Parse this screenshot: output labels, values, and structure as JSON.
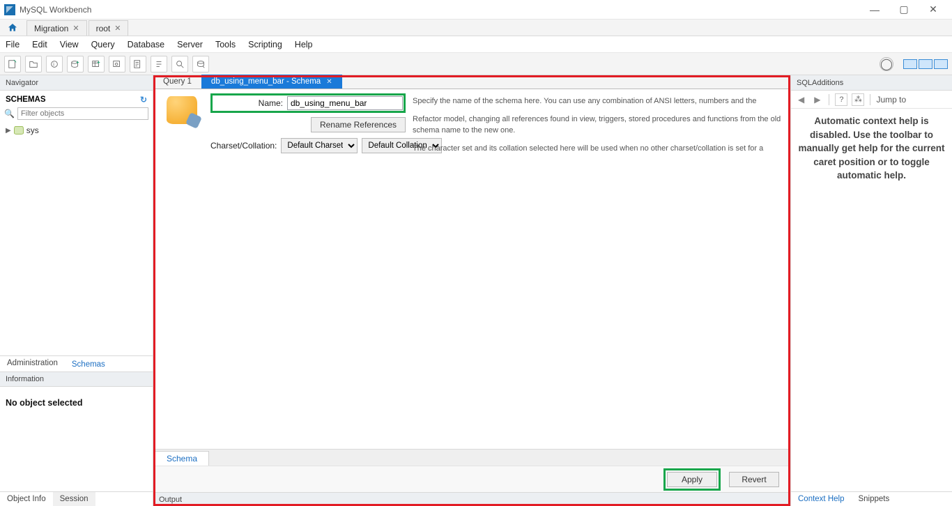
{
  "app_title": "MySQL Workbench",
  "window_controls": {
    "min": "—",
    "max": "▢",
    "close": "✕"
  },
  "app_tabs": [
    {
      "label": "Migration",
      "closable": true
    },
    {
      "label": "root",
      "closable": true
    }
  ],
  "menu": [
    "File",
    "Edit",
    "View",
    "Query",
    "Database",
    "Server",
    "Tools",
    "Scripting",
    "Help"
  ],
  "navigator": {
    "title": "Navigator",
    "schemas_label": "SCHEMAS",
    "filter_placeholder": "Filter objects",
    "tree_items": [
      {
        "label": "sys"
      }
    ],
    "bottom_tabs": {
      "admin": "Administration",
      "schemas": "Schemas"
    },
    "info_title": "Information",
    "info_body": "No object selected",
    "info_tabs": {
      "object": "Object Info",
      "session": "Session"
    }
  },
  "editor": {
    "tabs": [
      {
        "label": "Query 1",
        "active": false
      },
      {
        "label": "db_using_menu_bar - Schema",
        "active": true
      }
    ],
    "name_label": "Name:",
    "name_value": "db_using_menu_bar",
    "rename_btn": "Rename References",
    "charset_label": "Charset/Collation:",
    "charset_value": "Default Charset",
    "collation_value": "Default Collation",
    "help_name": "Specify the name of the schema here. You can use any combination of ANSI letters, numbers and the",
    "help_refactor": "Refactor model, changing all references found in view, triggers, stored procedures and functions from the old schema name to the new one.",
    "help_charset": "The character set and its collation selected here will be used when no other charset/collation is set for a",
    "bottom_tab": "Schema",
    "apply": "Apply",
    "revert": "Revert",
    "output_title": "Output"
  },
  "additions": {
    "title": "SQLAdditions",
    "jump_label": "Jump to",
    "help_text": "Automatic context help is disabled. Use the toolbar to manually get help for the current caret position or to toggle automatic help.",
    "bottom_tabs": {
      "context": "Context Help",
      "snippets": "Snippets"
    }
  }
}
